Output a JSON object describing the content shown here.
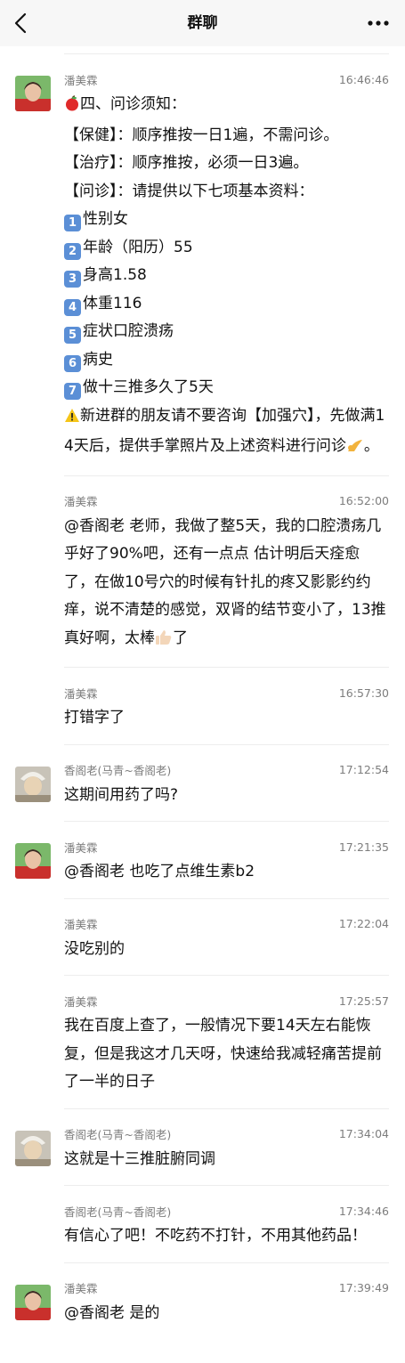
{
  "topbar": {
    "title": "群聊"
  },
  "messages": [
    {
      "sender": "潘美霖",
      "time": "16:46:46",
      "lines": {
        "l1": "四、问诊须知：",
        "l2": "【保健】：顺序推按一日1遍，不需问诊。",
        "l3": "【治疗】：顺序推按，必须一日3遍。",
        "l4": "【问诊】：请提供以下七项基本资料：",
        "n1": "1",
        "i1": "性别女",
        "n2": "2",
        "i2": "年龄（阳历）55",
        "n3": "3",
        "i3": "身高1.58",
        "n4": "4",
        "i4": "体重116",
        "n5": "5",
        "i5": "症状口腔溃疡",
        "n6": "6",
        "i6": "病史",
        "n7": "7",
        "i7": "做十三推多久了5天",
        "warn": "新进群的朋友请不要咨询【加强穴】，先做满14天后，提供手掌照片及上述资料进行问诊",
        "end": "。"
      }
    },
    {
      "sender": "潘美霖",
      "time": "16:52:00",
      "text_a": "@香阁老 老师，我做了整5天，我的口腔溃疡几乎好了90%吧，还有一点点 估计明后天痊愈了，在做10号穴的时候有针扎的疼又影影约约痒，说不清楚的感觉，双肾的结节变小了，13推真好啊，太棒",
      "text_b": "了"
    },
    {
      "sender": "潘美霖",
      "time": "16:57:30",
      "text": "打错字了"
    },
    {
      "sender": "香阁老(马青~香阁老)",
      "time": "17:12:54",
      "text": "这期间用药了吗?"
    },
    {
      "sender": "潘美霖",
      "time": "17:21:35",
      "text": "@香阁老 也吃了点维生素b2"
    },
    {
      "sender": "潘美霖",
      "time": "17:22:04",
      "text": "没吃别的"
    },
    {
      "sender": "潘美霖",
      "time": "17:25:57",
      "text": "我在百度上查了，一般情况下要14天左右能恢复，但是我这才几天呀，快速给我减轻痛苦提前了一半的日子"
    },
    {
      "sender": "香阁老(马青~香阁老)",
      "time": "17:34:04",
      "text": "这就是十三推脏腑同调"
    },
    {
      "sender": "香阁老(马青~香阁老)",
      "time": "17:34:46",
      "text": "有信心了吧！不吃药不打针，不用其他药品！"
    },
    {
      "sender": "潘美霖",
      "time": "17:39:49",
      "text": "@香阁老 是的"
    }
  ],
  "icons": {
    "back": "chevron-left-icon",
    "more": "more-dots-icon",
    "apple": "red-apple-emoji",
    "warning": "warning-emoji",
    "bow": "bow-emoji",
    "thumb": "thumbs-up-emoji"
  },
  "colors": {
    "topbar_bg": "#f7f7f7",
    "meta_text": "#7d7d7d",
    "keycap": "#5b8fd6",
    "separator": "#ededed"
  }
}
